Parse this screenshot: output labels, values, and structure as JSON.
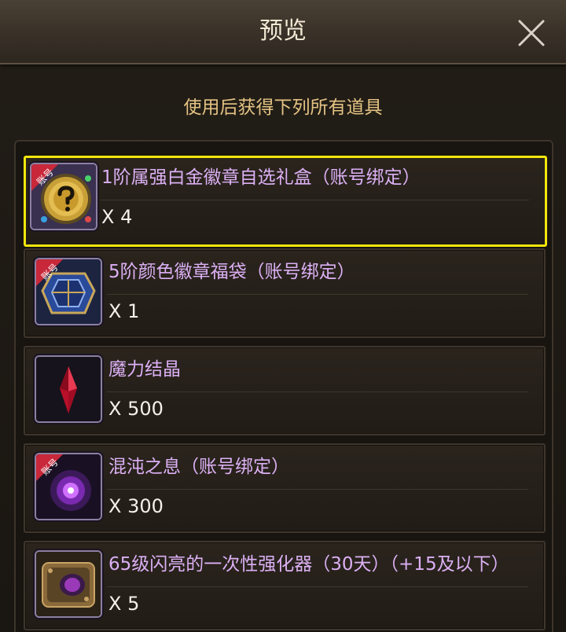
{
  "dialog": {
    "title": "预览",
    "subtitle": "使用后获得下列所有道具"
  },
  "items": [
    {
      "name": "1阶属强白金徽章自选礼盒（账号绑定）",
      "qty": "X 4",
      "badge": "账号",
      "icon": "gold-question-coin-icon",
      "selected": true
    },
    {
      "name": "5阶颜色徽章福袋（账号绑定）",
      "qty": "X 1",
      "badge": "账号",
      "icon": "blue-badge-bag-icon",
      "selected": false
    },
    {
      "name": "魔力结晶",
      "qty": "X 500",
      "badge": "",
      "icon": "red-crystal-icon",
      "selected": false
    },
    {
      "name": "混沌之息（账号绑定）",
      "qty": "X 300",
      "badge": "账号",
      "icon": "purple-chaos-orb-icon",
      "selected": false
    },
    {
      "name": "65级闪亮的一次性强化器（30天）（+15及以下）",
      "qty": "X 5",
      "badge": "",
      "icon": "enhancer-device-icon",
      "selected": false
    }
  ],
  "colors": {
    "item_name": "#dcb0f4",
    "quantity": "#f4f0ea",
    "subtitle": "#e4c383",
    "selected_border": "#f2e60c"
  }
}
